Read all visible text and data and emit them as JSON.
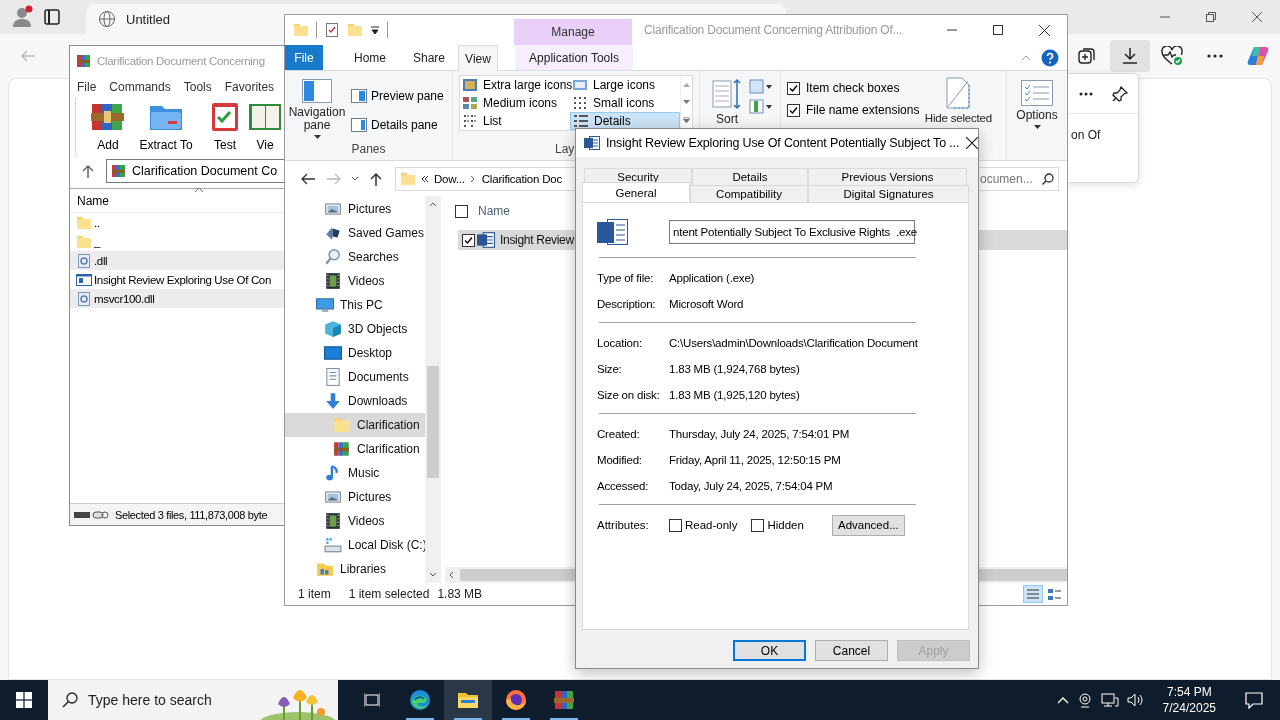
{
  "browser": {
    "tab_title": "Untitled",
    "download_item": "on Of"
  },
  "winrar": {
    "title": "Clarification Document Concerning",
    "menu": [
      "File",
      "Commands",
      "Tools",
      "Favorites"
    ],
    "toolbar": [
      {
        "label": "Add",
        "kind": "archive"
      },
      {
        "label": "Extract To",
        "kind": "extract"
      },
      {
        "label": "Test",
        "kind": "test"
      },
      {
        "label": "Vie",
        "kind": "view"
      }
    ],
    "path": "Clarification Document Co",
    "column": "Name",
    "files": [
      {
        "name": "..",
        "kind": "folder",
        "selected": false
      },
      {
        "name": "_",
        "kind": "folder",
        "selected": false
      },
      {
        "name": ".dll",
        "kind": "dll",
        "selected": true
      },
      {
        "name": "Insight Review Exploring Use Of Con",
        "kind": "exe",
        "selected": false
      },
      {
        "name": "msvcr100.dll",
        "kind": "dll",
        "selected": true
      }
    ],
    "status": "Selected 3 files, 111,873,008 byte"
  },
  "explorer": {
    "title": "Clarification Document Concerning Attribution Of...",
    "context_group": "Manage",
    "tabs": [
      {
        "label": "File",
        "kind": "file",
        "selected": false
      },
      {
        "label": "Home",
        "kind": "tab",
        "selected": false
      },
      {
        "label": "Share",
        "kind": "tab",
        "selected": false
      },
      {
        "label": "View",
        "kind": "tab",
        "selected": true
      },
      {
        "label": "Application Tools",
        "kind": "context",
        "selected": false
      }
    ],
    "ribbon": {
      "panes": {
        "label": "Panes",
        "navigation_pane": "Navigation pane",
        "items": [
          "Preview pane",
          "Details pane"
        ]
      },
      "layout": {
        "label": "Lay",
        "options": [
          {
            "label": "Extra large icons",
            "selected": false
          },
          {
            "label": "Large icons",
            "selected": false
          },
          {
            "label": "Medium icons",
            "selected": false
          },
          {
            "label": "Small icons",
            "selected": false
          },
          {
            "label": "List",
            "selected": false
          },
          {
            "label": "Details",
            "selected": true
          }
        ]
      },
      "sort": "Sort",
      "show_hide": {
        "options": [
          {
            "label": "Item check boxes",
            "checked": true
          },
          {
            "label": "File name extensions",
            "checked": true
          }
        ],
        "hide_selected": "Hide selected"
      },
      "options": "Options"
    },
    "breadcrumb": [
      "Dow...",
      "Clarification Doc"
    ],
    "search": {
      "placeholder": "ocumen..."
    },
    "nav_tree": {
      "partial_children": [
        {
          "label": "Pictures",
          "kind": "pictures",
          "selected": false
        },
        {
          "label": "Saved Games",
          "kind": "games",
          "selected": false
        },
        {
          "label": "Searches",
          "kind": "search",
          "selected": false
        },
        {
          "label": "Videos",
          "kind": "videos",
          "selected": false
        }
      ],
      "items": [
        {
          "label": "This PC",
          "kind": "pc",
          "selected": false,
          "children": [
            {
              "label": "3D Objects",
              "kind": "cube",
              "selected": false
            },
            {
              "label": "Desktop",
              "kind": "desktop",
              "selected": false
            },
            {
              "label": "Documents",
              "kind": "documents",
              "selected": false
            },
            {
              "label": "Downloads",
              "kind": "downloads",
              "selected": false,
              "children": [
                {
                  "label": "Clarification",
                  "kind": "folder",
                  "selected": true
                },
                {
                  "label": "Clarification",
                  "kind": "archive",
                  "selected": false
                }
              ]
            },
            {
              "label": "Music",
              "kind": "music",
              "selected": false
            },
            {
              "label": "Pictures",
              "kind": "pictures",
              "selected": false
            },
            {
              "label": "Videos",
              "kind": "videos",
              "selected": false
            },
            {
              "label": "Local Disk (C:)",
              "kind": "disk",
              "selected": false
            }
          ]
        },
        {
          "label": "Libraries",
          "kind": "libraries",
          "selected": false
        }
      ]
    },
    "list": {
      "column": "Name",
      "all_checked": false,
      "rows": [
        {
          "name": "Insight Review",
          "checked": true,
          "selected": true
        }
      ]
    },
    "status": [
      "1 item",
      "1 item selected",
      "1.83 MB"
    ],
    "views": [
      {
        "kind": "details",
        "selected": true
      },
      {
        "kind": "tiles",
        "selected": false
      }
    ]
  },
  "dialog": {
    "title": "Insight Review Exploring Use Of Content Potentially Subject To ...",
    "tab_rows": [
      [
        {
          "label": "Security",
          "selected": false
        },
        {
          "label": "Details",
          "selected": false
        },
        {
          "label": "Previous Versions",
          "selected": false
        }
      ],
      [
        {
          "label": "General",
          "selected": true
        },
        {
          "label": "Compatibility",
          "selected": false
        },
        {
          "label": "Digital Signatures",
          "selected": false
        }
      ]
    ],
    "file_name": "ntent Potentially Subject To Exclusive Rights  .exe",
    "groups": [
      [
        {
          "label": "Type of file:",
          "value": "Application (.exe)"
        },
        {
          "label": "Description:",
          "value": "Microsoft Word"
        }
      ],
      [
        {
          "label": "Location:",
          "value": "C:\\Users\\admin\\Downloads\\Clarification Document"
        },
        {
          "label": "Size:",
          "value": "1.83 MB (1,924,768 bytes)"
        },
        {
          "label": "Size on disk:",
          "value": "1.83 MB (1,925,120 bytes)"
        }
      ],
      [
        {
          "label": "Created:",
          "value": "Thursday, July 24, 2025, 7:54:01 PM"
        },
        {
          "label": "Modified:",
          "value": "Friday, April 11, 2025, 12:50:15 PM"
        },
        {
          "label": "Accessed:",
          "value": "Today, July 24, 2025, 7:54:04 PM"
        }
      ]
    ],
    "attributes": {
      "label": "Attributes:",
      "options": [
        {
          "label": "Read-only",
          "checked": false
        },
        {
          "label": "Hidden",
          "checked": false
        }
      ],
      "advanced": "Advanced..."
    },
    "buttons": [
      {
        "label": "OK",
        "default": true,
        "disabled": false
      },
      {
        "label": "Cancel",
        "default": false,
        "disabled": false
      },
      {
        "label": "Apply",
        "default": false,
        "disabled": true
      }
    ]
  },
  "taskbar": {
    "search_placeholder": "Type here to search",
    "apps": [
      {
        "kind": "taskview",
        "running": false,
        "active": false
      },
      {
        "kind": "edge",
        "running": true,
        "active": false
      },
      {
        "kind": "explorer",
        "running": true,
        "active": true
      },
      {
        "kind": "firefox",
        "running": true,
        "active": false
      },
      {
        "kind": "winrar",
        "running": true,
        "active": false
      }
    ],
    "time": "7:54 PM",
    "date": "7/24/2025"
  }
}
